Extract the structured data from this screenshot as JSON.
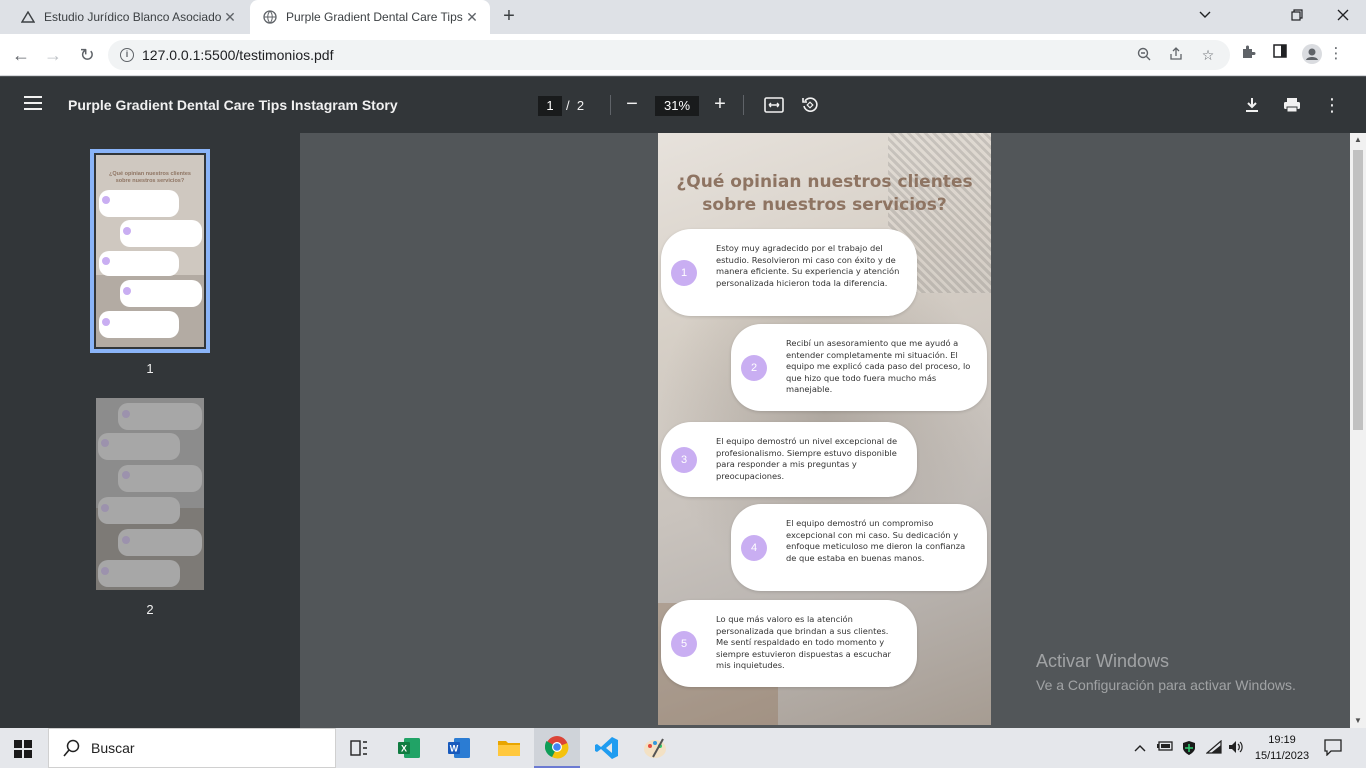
{
  "browser": {
    "tabs": [
      {
        "title": "Estudio Jurídico Blanco Asociado",
        "active": false
      },
      {
        "title": "Purple Gradient Dental Care Tips",
        "active": true
      }
    ],
    "url": "127.0.0.1:5500/testimonios.pdf"
  },
  "pdf_viewer": {
    "document_title": "Purple Gradient Dental Care Tips Instagram Story",
    "current_page": "1",
    "page_separator": "/",
    "total_pages": "2",
    "zoom": "31%",
    "thumbnails": [
      {
        "label": "1",
        "selected": true
      },
      {
        "label": "2",
        "selected": false
      }
    ]
  },
  "page_content": {
    "heading_line1": "¿Qué opinian nuestros clientes",
    "heading_line2": "sobre nuestros servicios?",
    "testimonials": [
      {
        "number": "1",
        "text": "Estoy muy agradecido por el trabajo del estudio. Resolvieron mi caso con éxito y de manera eficiente. Su experiencia y atención personalizada hicieron toda la diferencia."
      },
      {
        "number": "2",
        "text": "Recibí un asesoramiento que me ayudó a entender completamente mi situación. El equipo me explicó cada paso del proceso, lo que hizo que todo fuera mucho más manejable."
      },
      {
        "number": "3",
        "text": "El equipo demostró un nivel excepcional de profesionalismo. Siempre estuvo disponible para responder a mis preguntas y preocupaciones."
      },
      {
        "number": "4",
        "text": "El equipo demostró un compromiso excepcional con mi caso. Su dedicación y enfoque meticuloso me dieron la confianza de que estaba en buenas manos."
      },
      {
        "number": "5",
        "text": "Lo que más valoro es la atención personalizada que brindan a sus clientes. Me sentí respaldado en todo momento y siempre estuvieron dispuestas a escuchar mis inquietudes."
      }
    ]
  },
  "watermark": {
    "line1": "Activar Windows",
    "line2": "Ve a Configuración para activar Windows."
  },
  "taskbar": {
    "search_placeholder": "Buscar",
    "time": "19:19",
    "date": "15/11/2023"
  },
  "colors": {
    "accent_bubble_number": "#c9aef2",
    "heading": "#8e7462",
    "toolbar": "#323639",
    "viewer_bg": "#525659"
  }
}
